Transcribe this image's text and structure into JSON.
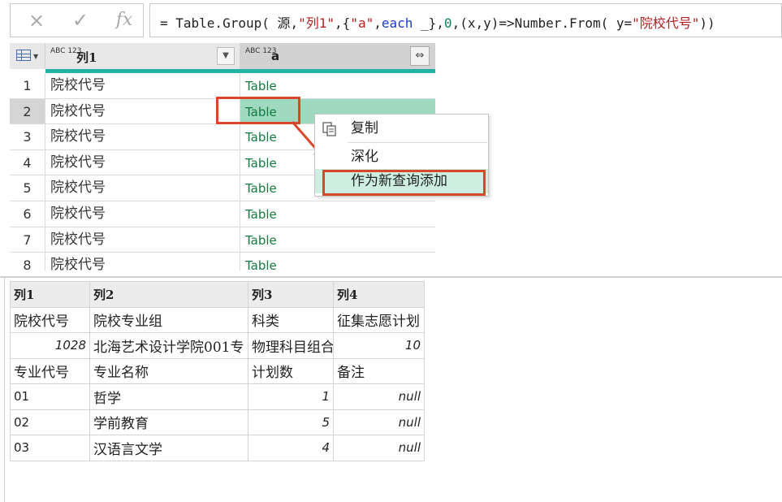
{
  "formula_bar": {
    "cancel_icon": "×",
    "commit_icon": "✓",
    "fx_icon": "fx",
    "formula_prefix": "= Table.Group( 源,",
    "str1": "\"列1\"",
    "mid1": ",{",
    "str2": "\"a\"",
    "mid2": ",",
    "kw_each": "each",
    "mid3": " _},",
    "num0": "0",
    "mid4": ",(x,y)=>Number.From( y=",
    "str3": "\"院校代号\"",
    "suffix": "))"
  },
  "top_grid": {
    "col1_type": "ABC 123",
    "col1_header": "列1",
    "cola_type": "ABC 123",
    "cola_header": "a",
    "filter_icon": "▼",
    "expand_icon": "⇔",
    "rows": [
      {
        "num": "1",
        "c1": "院校代号",
        "c2": "Table"
      },
      {
        "num": "2",
        "c1": "院校代号",
        "c2": "Table"
      },
      {
        "num": "3",
        "c1": "院校代号",
        "c2": "Table"
      },
      {
        "num": "4",
        "c1": "院校代号",
        "c2": "Table"
      },
      {
        "num": "5",
        "c1": "院校代号",
        "c2": "Table"
      },
      {
        "num": "6",
        "c1": "院校代号",
        "c2": "Table"
      },
      {
        "num": "7",
        "c1": "院校代号",
        "c2": "Table"
      },
      {
        "num": "8",
        "c1": "院校代号",
        "c2": "Table"
      }
    ]
  },
  "context_menu": {
    "copy": "复制",
    "drill": "深化",
    "add_query": "作为新查询添加"
  },
  "bottom_grid": {
    "headers": [
      "列1",
      "列2",
      "列3",
      "列4"
    ],
    "rows": [
      [
        "院校代号",
        "院校专业组",
        "科类",
        "征集志愿计划"
      ],
      [
        "1028",
        "北海艺术设计学院001专",
        "物理科目组合",
        "10"
      ],
      [
        "专业代号",
        "专业名称",
        "计划数",
        "备注"
      ],
      [
        "01",
        "哲学",
        "1",
        "null"
      ],
      [
        "02",
        "学前教育",
        "5",
        "null"
      ],
      [
        "03",
        "汉语言文学",
        "4",
        "null"
      ]
    ]
  },
  "colors": {
    "accent_teal": "#21b4a4",
    "highlight_red": "#d9472b",
    "table_link_green": "#127b3d"
  }
}
